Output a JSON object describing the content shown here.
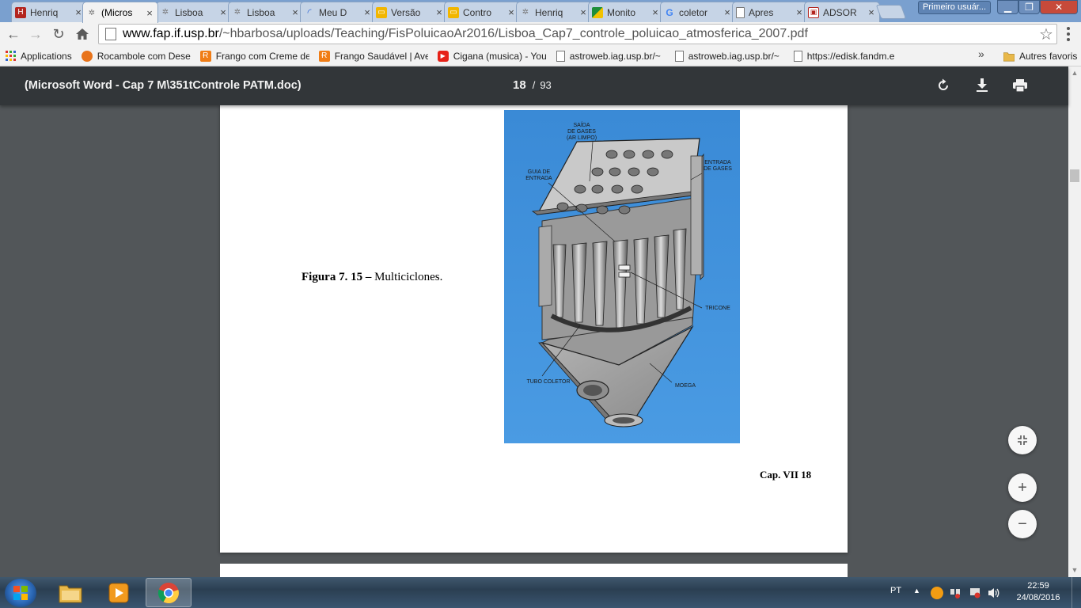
{
  "browser": {
    "tabs": [
      {
        "label": "Henriq",
        "icon": "red-brand-icon",
        "active": false
      },
      {
        "label": "(Micros",
        "icon": "network-globe-icon",
        "active": true
      },
      {
        "label": "Lisboa",
        "icon": "network-globe-icon",
        "active": false
      },
      {
        "label": "Lisboa",
        "icon": "network-globe-icon",
        "active": false
      },
      {
        "label": "Meu D",
        "icon": "loading-spinner-icon",
        "active": false
      },
      {
        "label": "Versão",
        "icon": "slides-icon",
        "active": false
      },
      {
        "label": "Contro",
        "icon": "slides-icon",
        "active": false
      },
      {
        "label": "Henriq",
        "icon": "network-globe-icon",
        "active": false
      },
      {
        "label": "Monito",
        "icon": "flag-icon",
        "active": false
      },
      {
        "label": "coletor",
        "icon": "google-icon",
        "active": false
      },
      {
        "label": "Apres",
        "icon": "document-icon",
        "active": false
      },
      {
        "label": "ADSOR",
        "icon": "monitor-icon",
        "active": false
      }
    ],
    "profile_label": "Primeiro usuár...",
    "url_host": "www.fap.if.usp.br",
    "url_path": "/~hbarbosa/uploads/Teaching/FisPoluicaoAr2016/Lisboa_Cap7_controle_poluicao_atmosferica_2007.pdf",
    "bookmarks": [
      {
        "label": "Applications",
        "icon": "apps-grid-icon"
      },
      {
        "label": "Rocambole com Dese",
        "icon": "orange-circle-icon"
      },
      {
        "label": "Frango com Creme de",
        "icon": "recipe-icon"
      },
      {
        "label": "Frango Saudável | Ave",
        "icon": "recipe-icon"
      },
      {
        "label": "Cigana (musica) - You",
        "icon": "youtube-icon"
      },
      {
        "label": "astroweb.iag.usp.br/~",
        "icon": "page-icon"
      },
      {
        "label": "astroweb.iag.usp.br/~",
        "icon": "page-icon"
      },
      {
        "label": "https://edisk.fandm.ec",
        "icon": "page-icon"
      }
    ],
    "bookmarks_more": "»",
    "other_bookmarks": "Autres favoris"
  },
  "pdf": {
    "title": "(Microsoft Word - Cap 7 M\\351tControle PATM.doc)",
    "current_page": "18",
    "page_separator": "/",
    "total_pages": "93",
    "caption_bold": "Figura 7. 15 –",
    "caption_text": "Multiciclones.",
    "footer": "Cap. VII  18",
    "figure_labels": {
      "saida": [
        "SAÍDA",
        "DE GASES",
        "(AR LIMPO)"
      ],
      "entrada": [
        "ENTRADA",
        "DE GASES"
      ],
      "guia": [
        "GUIA DE",
        "ENTRADA"
      ],
      "tricone": "TRICONE",
      "tubo": "TUBO COLETOR",
      "moega": "MOEGA"
    }
  },
  "taskbar": {
    "language": "PT",
    "time": "22:59",
    "date": "24/08/2016",
    "pinned": [
      "file-explorer-icon",
      "media-player-icon",
      "chrome-icon"
    ]
  },
  "colors": {
    "tabstrip": "#7aa0cf",
    "pdf_toolbar": "#323639",
    "viewer_bg": "#525659",
    "figure_blue": "#3f8fd8"
  }
}
